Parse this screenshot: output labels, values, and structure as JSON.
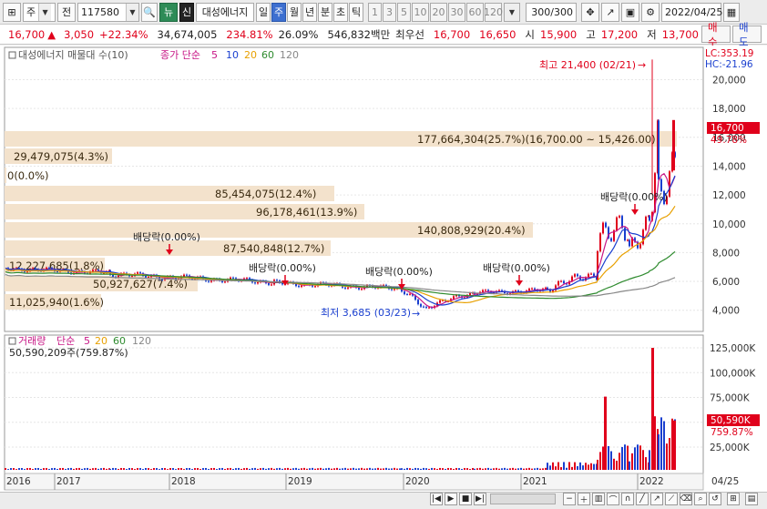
{
  "toolbar": {
    "market": "주",
    "mode": "전",
    "code": "117580",
    "news_badge": "뉴",
    "credit_badge": "신",
    "stock_name": "대성에너지",
    "periods": [
      "일",
      "주",
      "월",
      "년",
      "분",
      "초",
      "틱"
    ],
    "active_period": "주",
    "intervals": [
      "1",
      "3",
      "5",
      "10",
      "20",
      "30",
      "60",
      "120"
    ],
    "count_display": "300",
    "count_total": "/300",
    "date": "2022/04/25"
  },
  "quote": {
    "price": "16,700",
    "change_arrow": "▲",
    "change": "3,050",
    "change_pct": "+22.34%",
    "volume": "34,674,005",
    "vol_ratio": "234.81%",
    "turnover": "26.09%",
    "amount": "546,832백만",
    "priority_label": "최우선",
    "ask": "16,700",
    "bid": "16,650",
    "open_label": "시",
    "open": "15,900",
    "high_label": "고",
    "high": "17,200",
    "low_label": "저",
    "low": "13,700",
    "buy_label": "매수",
    "sell_label": "매도"
  },
  "price_panel": {
    "legend_indicator": "대성에너지 매물대 수(10)",
    "legend_ma_label": "종가 단순",
    "legend_ma_periods": [
      "5",
      "10",
      "20",
      "60",
      "120"
    ],
    "lc_label": "LC:353.19",
    "hc_label": "HC:-21.96",
    "high_note": "최고 21,400 (02/21)",
    "low_note": "최저 3,685 (03/23)",
    "current_price_tag": "16,700",
    "current_pct_tag": "49.78%",
    "y_ticks": [
      "20,000",
      "18,000",
      "16,000",
      "14,000",
      "12,000",
      "10,000",
      "8,000",
      "6,000",
      "4,000"
    ],
    "volume_profile": [
      "177,664,304(25.7%)(16,700.00 ~ 15,426.00)",
      "29,479,075(4.3%)",
      "0(0.0%)",
      "85,454,075(12.4%)",
      "96,178,461(13.9%)",
      "140,808,929(20.4%)",
      "87,540,848(12.7%)",
      "12,227,685(1.8%)",
      "50,927,627(7.4%)",
      "11,025,940(1.6%)"
    ],
    "dividend_label": "배당락(0.00%)"
  },
  "volume_panel": {
    "legend_label": "거래량",
    "legend_ma_label": "단순",
    "legend_ma_periods": [
      "5",
      "20",
      "60",
      "120"
    ],
    "current_volume": "50,590,209주(759.87%)",
    "current_volume_tag": "50,590K",
    "current_pct_tag": "759.87%",
    "y_ticks": [
      "125,000K",
      "100,000K",
      "75,000K",
      "50,000K",
      "25,000K"
    ]
  },
  "x_axis": {
    "years": [
      "2016",
      "2017",
      "2018",
      "2019",
      "2020",
      "2021",
      "2022"
    ],
    "last_label": "04/25"
  },
  "colors": {
    "up": "#e0001b",
    "down": "#1a3fcf",
    "ma5": "#c71585",
    "ma10": "#1a3fcf",
    "ma20": "#e8a000",
    "ma60": "#2e8b2e",
    "ma120": "#888888",
    "profile_bar": "#f3e2cc"
  }
}
